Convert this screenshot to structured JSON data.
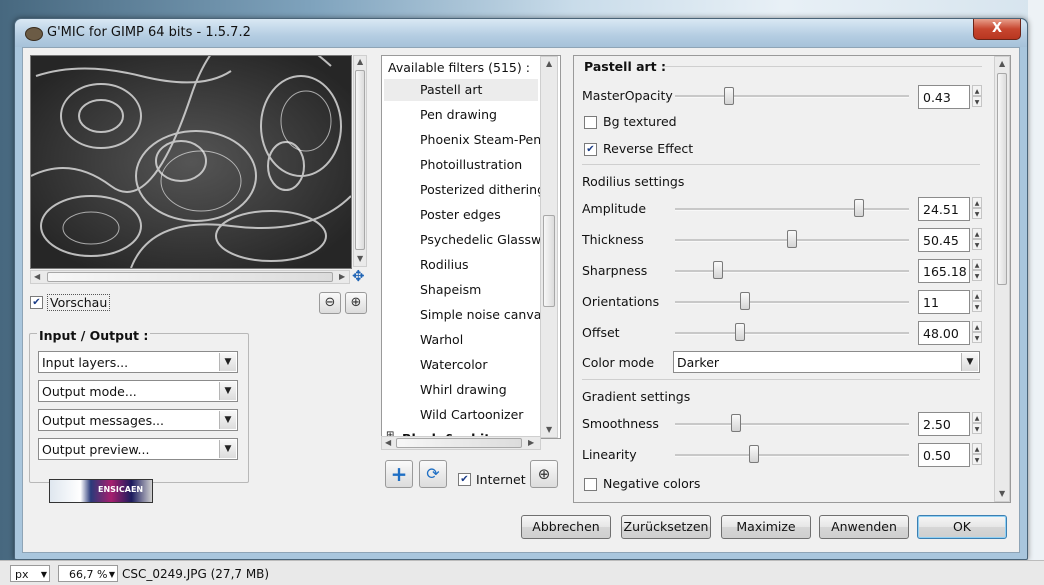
{
  "window": {
    "title": "G'MIC for GIMP 64 bits - 1.5.7.2",
    "close_label": "X"
  },
  "preview": {
    "checkbox_label": "Vorschau",
    "checked": true
  },
  "io_group": {
    "title": "Input / Output :",
    "combos": [
      "Input layers...",
      "Output mode...",
      "Output messages...",
      "Output preview..."
    ]
  },
  "logo_text": "ENSICAEN",
  "filters": {
    "header": "Available filters (515) :",
    "items": [
      "Pastell art",
      "Pen drawing",
      "Phoenix Steam-Penci",
      "Photoillustration",
      "Posterized dithering",
      "Poster edges",
      "Psychedelic Glasswo",
      "Rodilius",
      "Shapeism",
      "Simple noise canvas",
      "Warhol",
      "Watercolor",
      "Whirl drawing",
      "Wild Cartoonizer"
    ],
    "selected": "Pastell art",
    "next_category": "Black & white",
    "internet_label": "Internet",
    "internet_checked": true
  },
  "settings": {
    "title": "Pastell art :",
    "master_opacity": {
      "label": "MasterOpacity",
      "value": "0.43",
      "fraction": 0.22
    },
    "bg_textured": {
      "label": "Bg textured",
      "checked": false
    },
    "reverse_effect": {
      "label": "Reverse Effect",
      "checked": true
    },
    "rodilius_heading": "Rodilius settings",
    "rodilius": [
      {
        "label": "Amplitude",
        "value": "24.51",
        "fraction": 0.8
      },
      {
        "label": "Thickness",
        "value": "50.45",
        "fraction": 0.5
      },
      {
        "label": "Sharpness",
        "value": "165.18",
        "fraction": 0.17
      },
      {
        "label": "Orientations",
        "value": "11",
        "fraction": 0.29
      },
      {
        "label": "Offset",
        "value": "48.00",
        "fraction": 0.27
      }
    ],
    "color_mode": {
      "label": "Color mode",
      "value": "Darker"
    },
    "gradient_heading": "Gradient settings",
    "gradient": [
      {
        "label": "Smoothness",
        "value": "2.50",
        "fraction": 0.25
      },
      {
        "label": "Linearity",
        "value": "0.50",
        "fraction": 0.33
      }
    ],
    "negative_colors": {
      "label": "Negative colors",
      "checked": false
    }
  },
  "buttons": {
    "cancel": "Abbrechen",
    "reset": "Zurücksetzen",
    "maximize": "Maximize",
    "apply": "Anwenden",
    "ok": "OK"
  },
  "statusbar": {
    "unit": "px",
    "zoom": "66,7 %",
    "file": "CSC_0249.JPG (27,7 MB)"
  }
}
